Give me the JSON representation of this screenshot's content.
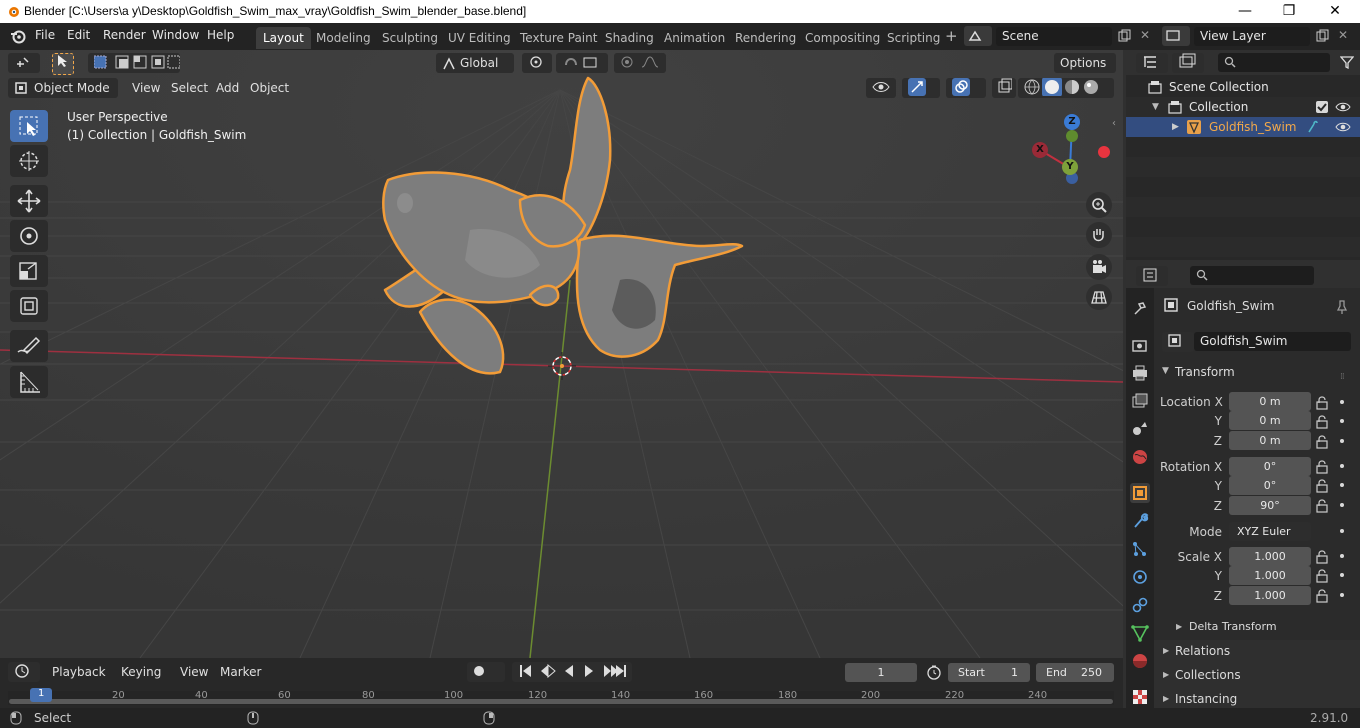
{
  "window": {
    "title": "Blender [C:\\Users\\a y\\Desktop\\Goldfish_Swim_max_vray\\Goldfish_Swim_blender_base.blend]",
    "minimize": "—",
    "maximize": "❐",
    "close": "✕"
  },
  "menu": [
    "File",
    "Edit",
    "Render",
    "Window",
    "Help"
  ],
  "workspaces": [
    "Layout",
    "Modeling",
    "Sculpting",
    "UV Editing",
    "Texture Paint",
    "Shading",
    "Animation",
    "Rendering",
    "Compositing",
    "Scripting"
  ],
  "active_workspace": "Layout",
  "scene": {
    "label": "Scene",
    "view_layer": "View Layer"
  },
  "viewport": {
    "mode": "Object Mode",
    "menus": [
      "View",
      "Select",
      "Add",
      "Object"
    ],
    "orientation": "Global",
    "options": "Options",
    "perspective": "User Perspective",
    "collection_info": "(1) Collection | Goldfish_Swim",
    "gizmo": {
      "x": "X",
      "y": "Y",
      "z": "Z"
    }
  },
  "outliner": {
    "rows": [
      {
        "label": "Scene Collection"
      },
      {
        "label": "Collection"
      },
      {
        "label": "Goldfish_Swim",
        "selected": true
      }
    ]
  },
  "properties": {
    "object_name": "Goldfish_Swim",
    "data_name": "Goldfish_Swim",
    "transform_title": "Transform",
    "location": {
      "label": "Location X",
      "x": "0 m",
      "y": "0 m",
      "z": "0 m"
    },
    "rotation": {
      "label": "Rotation X",
      "x": "0°",
      "y": "0°",
      "z": "90°"
    },
    "mode": {
      "label": "Mode",
      "value": "XYZ Euler"
    },
    "scale": {
      "label": "Scale X",
      "x": "1.000",
      "y": "1.000",
      "z": "1.000"
    },
    "axis_labels": {
      "y": "Y",
      "z": "Z"
    },
    "sections": [
      "Delta Transform",
      "Relations",
      "Collections",
      "Instancing"
    ]
  },
  "timeline": {
    "menus": [
      "Playback",
      "Keying",
      "View",
      "Marker"
    ],
    "current_frame": "1",
    "start_label": "Start",
    "start": "1",
    "end_label": "End",
    "end": "250",
    "ticks": [
      "1",
      "20",
      "40",
      "60",
      "80",
      "100",
      "120",
      "140",
      "160",
      "180",
      "200",
      "220",
      "240"
    ]
  },
  "status": {
    "left": "Select",
    "version": "2.91.0"
  },
  "colors": {
    "accent": "#4772b3",
    "selection_outline": "#f29c38",
    "x_axis": "#c2303f",
    "y_axis": "#7ea13a",
    "z_axis": "#3a7bd5"
  }
}
